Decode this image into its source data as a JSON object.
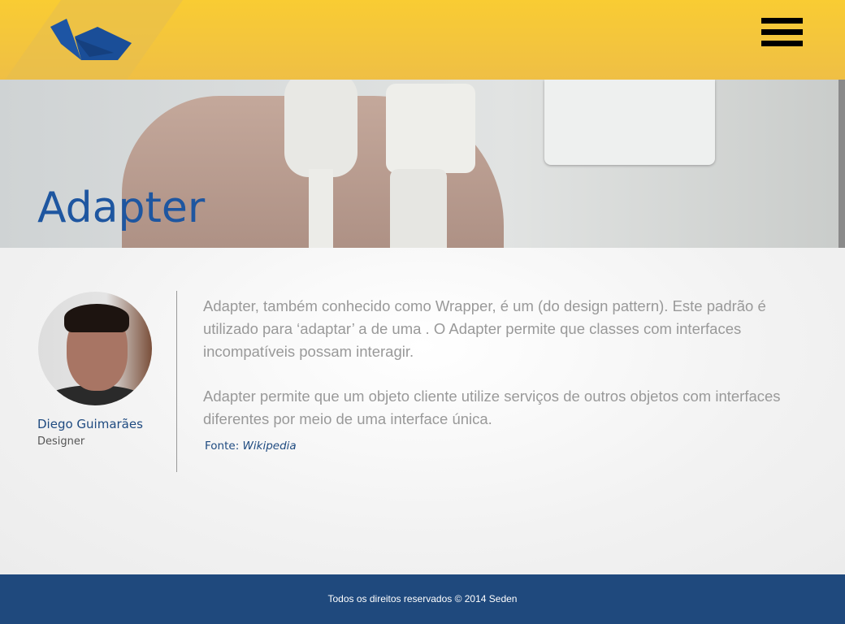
{
  "header": {
    "logo": "origami-bird-logo",
    "menu_icon": "hamburger-icon"
  },
  "hero": {
    "title": "Adapter"
  },
  "author": {
    "name": "Diego Guimarães",
    "role": "Designer"
  },
  "content": {
    "paragraphs": [
      "Adapter, também conhecido como Wrapper, é um  (do  design pattern). Este padrão é utilizado para ‘adaptar’ a  de uma . O Adapter permite que classes com interfaces incompatíveis possam interagir.",
      "Adapter permite que um objeto cliente utilize serviços de outros objetos com interfaces diferentes por meio de uma interface única."
    ],
    "source_label": "Fonte:",
    "source_link": "Wikipedia"
  },
  "footer": {
    "text": "Todos os direitos reservados © 2014 Seden"
  },
  "colors": {
    "header": "#f9cc33",
    "accent": "#1e56a0",
    "footer": "#1f497d"
  }
}
